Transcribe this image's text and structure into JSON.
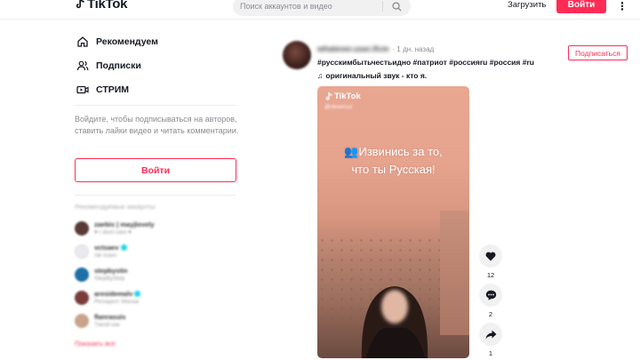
{
  "header": {
    "logo_text": "TikTok",
    "search_placeholder": "Поиск аккаунтов и видео",
    "upload_label": "Загрузить",
    "login_label": "Войти"
  },
  "sidebar": {
    "nav": [
      {
        "label": "Рекомендуем",
        "icon": "home-icon"
      },
      {
        "label": "Подписки",
        "icon": "users-icon"
      },
      {
        "label": "СТРИМ",
        "icon": "live-icon"
      }
    ],
    "hint": "Войдите, чтобы подписываться на авторов, ставить лайки видео и читать комментарии.",
    "login_label": "Войти",
    "suggested_title": "Рекомендуемые аккаунты",
    "accounts": [
      {
        "name": "zaebis | mayjlovely",
        "sub": "♥ I dont care ♥",
        "verified": false,
        "avatar_color": "#5a3a36"
      },
      {
        "name": "vctsaev",
        "sub": "nik tsaev",
        "verified": true,
        "avatar_color": "#e9eaf0"
      },
      {
        "name": "stepbystin",
        "sub": "StepByStep",
        "verified": false,
        "avatar_color": "#1d6fa5"
      },
      {
        "name": "aresidemalv",
        "sub": "Ресидент Мальв",
        "verified": true,
        "avatar_color": "#7a3b3b"
      },
      {
        "name": "flanrasuis",
        "sub": "Такой как",
        "verified": false,
        "avatar_color": "#c9a48a"
      }
    ],
    "see_all": "Показать все"
  },
  "post": {
    "author_name": "whatever.user.ifcm",
    "time": "· 1 дн. назад",
    "tags": "#русскимбытьчестьидно #патриот #россияru #россия #ru",
    "sound": "оригинальный звук - кто я.",
    "follow_label": "Подписаться",
    "video": {
      "brand": "TikTok",
      "handle": "@nksercur",
      "caption_line1": "Извинись за то,",
      "caption_line2": "что ты Русская!"
    },
    "actions": [
      {
        "icon": "heart-icon",
        "count": "12"
      },
      {
        "icon": "comment-icon",
        "count": "2"
      },
      {
        "icon": "share-icon",
        "count": "1"
      }
    ]
  },
  "colors": {
    "brand": "#fe2c55",
    "verified": "#20d5ec"
  }
}
